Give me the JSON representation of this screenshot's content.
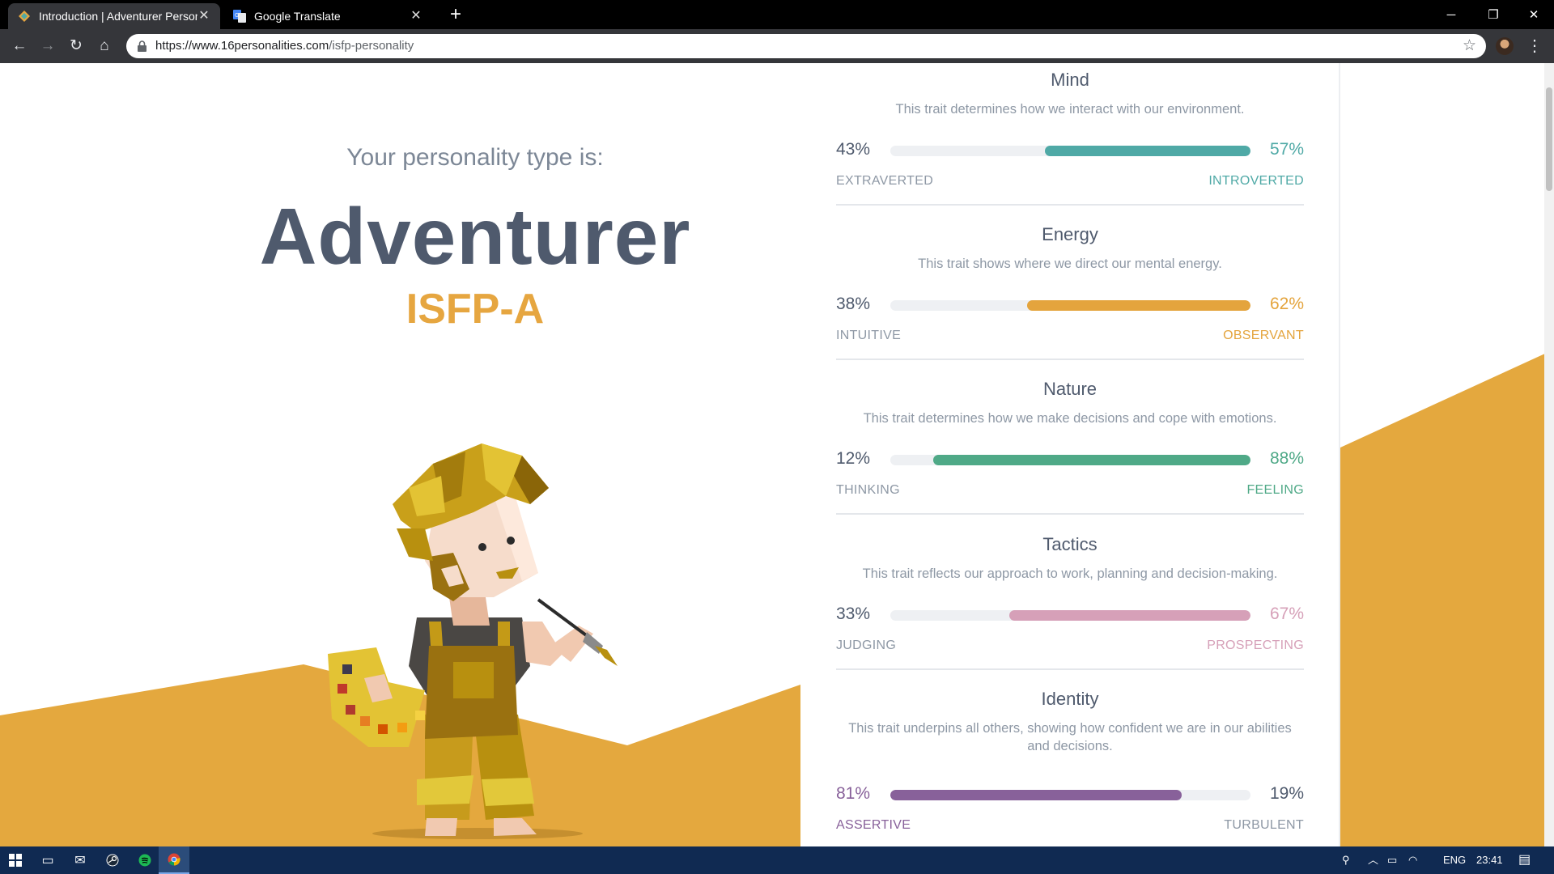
{
  "browser": {
    "tabs": [
      {
        "title": "Introduction | Adventurer Person",
        "active": true,
        "favicon": "16personalities-icon"
      },
      {
        "title": "Google Translate",
        "active": false,
        "favicon": "google-translate-icon"
      }
    ],
    "url_host": "https://www.16personalities.com",
    "url_path": "/isfp-personality"
  },
  "hero": {
    "subtitle": "Your personality type is:",
    "type_name": "Adventurer",
    "type_code": "ISFP-A"
  },
  "colors": {
    "accent_gold": "#e6a640",
    "mind": "#4fa9a6",
    "energy": "#e4a43d",
    "nature": "#4fa987",
    "tactics": "#d6a0b8",
    "identity": "#88619a",
    "heading": "#4f5a6d"
  },
  "traits": [
    {
      "name": "Mind",
      "description": "This trait determines how we interact with our environment.",
      "left_pct": "43%",
      "right_pct": "57%",
      "left_label": "EXTRAVERTED",
      "right_label": "INTROVERTED",
      "dominant": "right",
      "fill_fraction": 0.57,
      "color": "#4fa9a6"
    },
    {
      "name": "Energy",
      "description": "This trait shows where we direct our mental energy.",
      "left_pct": "38%",
      "right_pct": "62%",
      "left_label": "INTUITIVE",
      "right_label": "OBSERVANT",
      "dominant": "right",
      "fill_fraction": 0.62,
      "color": "#e4a43d"
    },
    {
      "name": "Nature",
      "description": "This trait determines how we make decisions and cope with emotions.",
      "left_pct": "12%",
      "right_pct": "88%",
      "left_label": "THINKING",
      "right_label": "FEELING",
      "dominant": "right",
      "fill_fraction": 0.88,
      "color": "#4fa987"
    },
    {
      "name": "Tactics",
      "description": "This trait reflects our approach to work, planning and decision-making.",
      "left_pct": "33%",
      "right_pct": "67%",
      "left_label": "JUDGING",
      "right_label": "PROSPECTING",
      "dominant": "right",
      "fill_fraction": 0.67,
      "color": "#d6a0b8"
    },
    {
      "name": "Identity",
      "description": "This trait underpins all others, showing how confident we are in our abilities and decisions.",
      "left_pct": "81%",
      "right_pct": "19%",
      "left_label": "ASSERTIVE",
      "right_label": "TURBULENT",
      "dominant": "left",
      "fill_fraction": 0.81,
      "color": "#88619a"
    }
  ],
  "taskbar": {
    "apps": [
      "windows-start-icon",
      "task-view-icon",
      "mail-icon",
      "steam-icon",
      "spotify-icon",
      "chrome-icon"
    ],
    "language": "ENG",
    "time": "23:41"
  }
}
